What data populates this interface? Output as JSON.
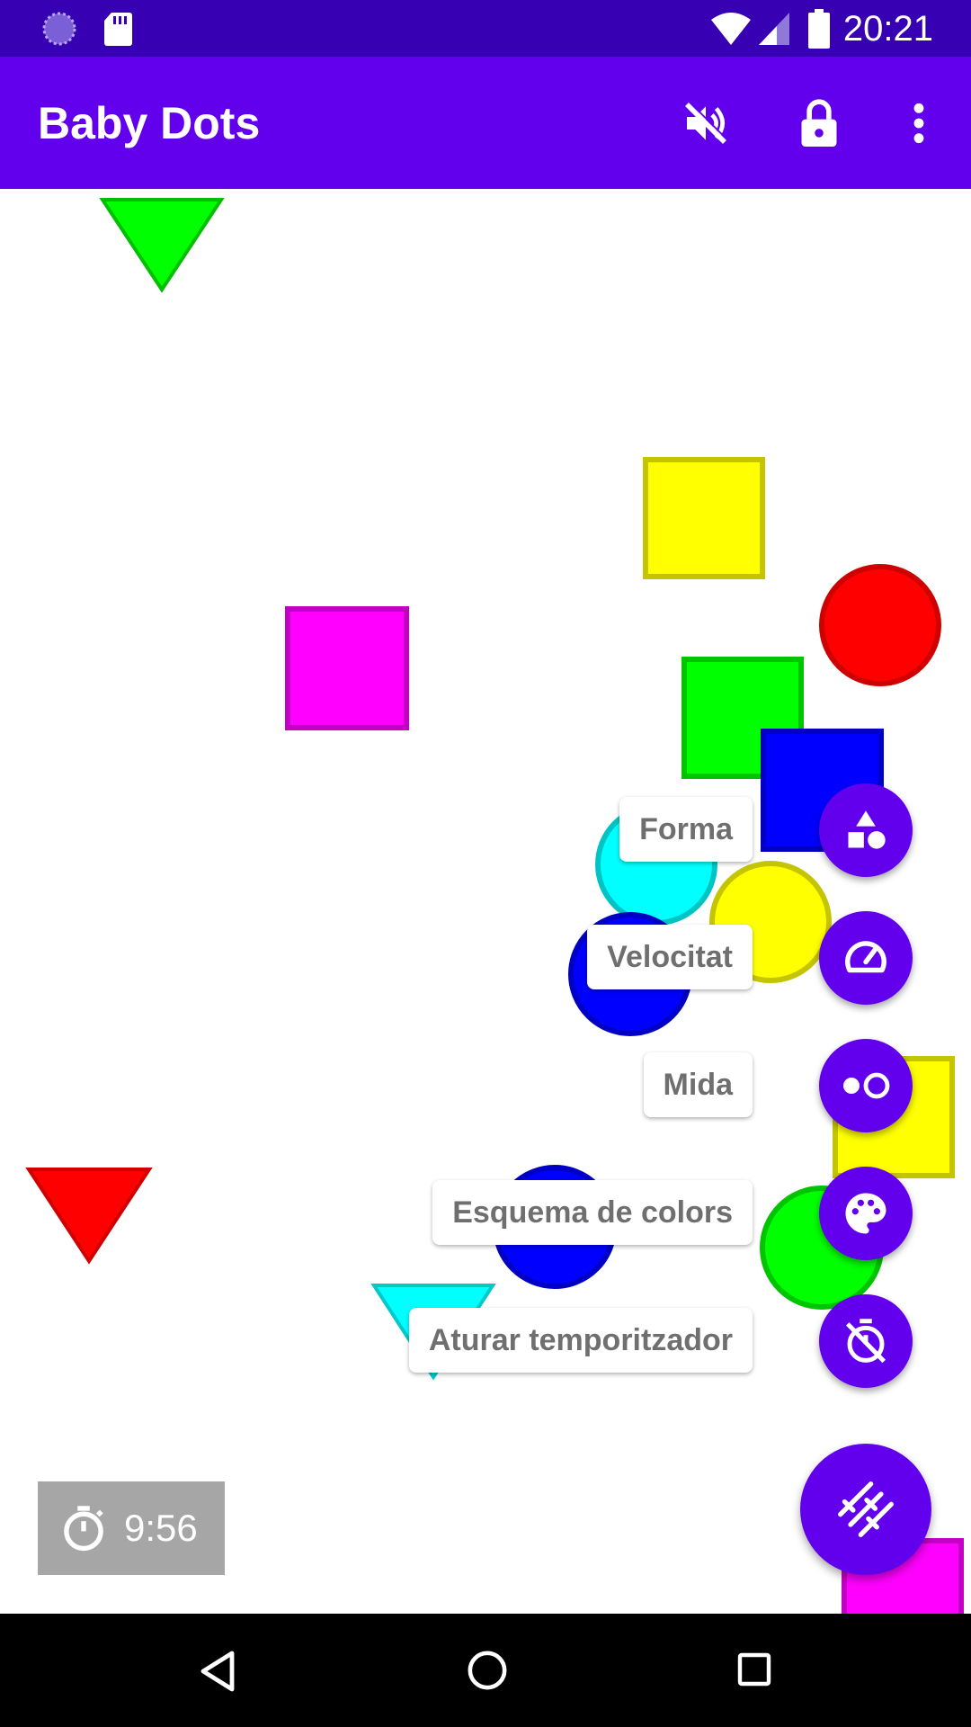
{
  "status_bar": {
    "time": "20:21",
    "left_icons": [
      "loading-circle-icon",
      "sd-card-icon"
    ],
    "right_icons": [
      "wifi-icon",
      "signal-icon",
      "battery-icon"
    ],
    "background": "#3700b3"
  },
  "app_bar": {
    "title": "Baby Dots",
    "actions": [
      "volume-off-icon",
      "lock-icon",
      "more-vert-icon"
    ],
    "background": "#6200ee"
  },
  "fab_menu": {
    "items": [
      {
        "label": "Forma",
        "icon": "shapes-icon"
      },
      {
        "label": "Velocitat",
        "icon": "speedometer-icon"
      },
      {
        "label": "Mida",
        "icon": "size-dots-icon"
      },
      {
        "label": "Esquema de colors",
        "icon": "palette-icon"
      },
      {
        "label": "Aturar temporitzador",
        "icon": "timer-off-icon"
      }
    ],
    "main_icon": "tune-icon",
    "accent": "#6200ee"
  },
  "timer": {
    "icon": "stopwatch-icon",
    "value": "9:56"
  },
  "shape_colors": {
    "green": "#00ff00",
    "yellow": "#ffff00",
    "red": "#ff0000",
    "magenta": "#ff00ff",
    "blue": "#0000ff",
    "cyan": "#00ffff"
  },
  "nav_bar": {
    "icons": [
      "back-icon",
      "home-icon",
      "recents-icon"
    ]
  }
}
